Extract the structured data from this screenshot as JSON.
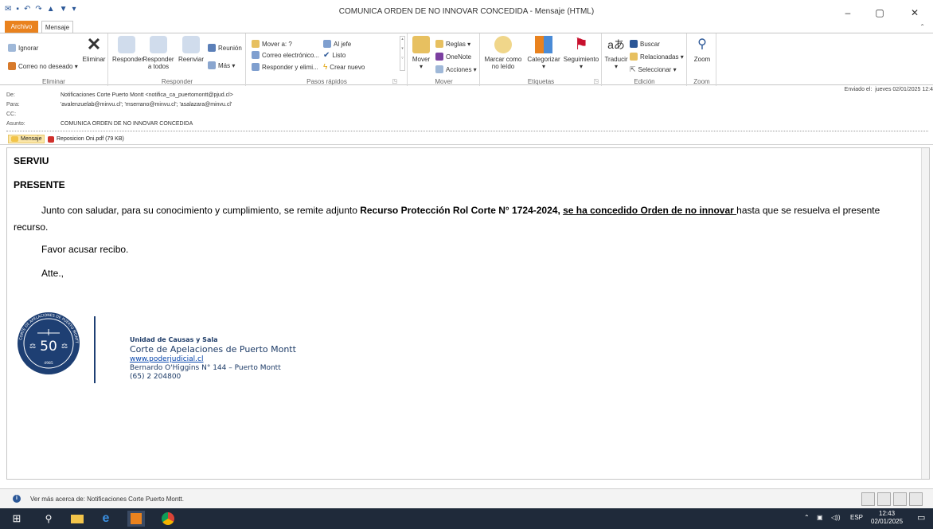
{
  "window": {
    "title": "COMUNICA ORDEN DE NO INNOVAR CONCEDIDA  -  Mensaje (HTML)",
    "controls": {
      "minimize": "–",
      "maximize": "▢",
      "close": "✕"
    }
  },
  "tabs": {
    "file": "Archivo",
    "message": "Mensaje",
    "collapse": "⌃"
  },
  "ribbon": {
    "delete_group": {
      "ignore": "Ignorar",
      "junk": "Correo no deseado ▾",
      "delete": "Eliminar",
      "label": "Eliminar"
    },
    "respond_group": {
      "reply": "Responder",
      "reply_all_1": "Responder",
      "reply_all_2": "a todos",
      "forward": "Reenviar",
      "meeting": "Reunión",
      "more": "Más ▾",
      "label": "Responder"
    },
    "quicksteps_group": {
      "move_to": "Mover a: ?",
      "boss": "Al jefe",
      "email": "Correo electrónico...",
      "done": "Listo",
      "reply_delete": "Responder y elimi...",
      "create_new": "Crear nuevo",
      "label": "Pasos rápidos"
    },
    "move_group": {
      "move": "Mover",
      "rules": "Reglas ▾",
      "onenote": "OneNote",
      "actions": "Acciones ▾",
      "label": "Mover"
    },
    "tags_group": {
      "mark_unread_1": "Marcar como",
      "mark_unread_2": "no leído",
      "categorize": "Categorizar",
      "followup": "Seguimiento",
      "label": "Etiquetas"
    },
    "edit_group": {
      "translate": "Traducir",
      "find": "Buscar",
      "related": "Relacionadas ▾",
      "select": "Seleccionar ▾",
      "label": "Edición"
    },
    "zoom_group": {
      "zoom": "Zoom",
      "label": "Zoom"
    }
  },
  "header": {
    "from_label": "De:",
    "from": "Notificaciones Corte Puerto Montt <notifica_ca_puertomontt@pjud.cl>",
    "to_label": "Para:",
    "to": "'avalenzuelab@minvu.cl'; 'mserrano@minvu.cl'; 'asalazara@minvu.cl'",
    "cc_label": "CC:",
    "cc": "",
    "subject_label": "Asunto:",
    "subject": "COMUNICA ORDEN DE NO INNOVAR CONCEDIDA",
    "sent_label": "Enviado el:",
    "sent": "jueves 02/01/2025 12:4"
  },
  "attachments": [
    {
      "name": "Mensaje"
    },
    {
      "name": "Reposicion Oni.pdf (79 KB)"
    }
  ],
  "body": {
    "line1": "SERVIU",
    "line2": "PRESENTE",
    "para_intro": "Junto con saludar, para su conocimiento y cumplimiento, se remite adjunto ",
    "para_bold": "Recurso Protección Rol Corte N° 1724-2024, ",
    "para_underlined": "se ha concedido Orden de no innovar ",
    "para_end": "hasta que se resuelva el presente",
    "para_wrap": "recurso.",
    "ack": "Favor acusar recibo.",
    "closing": "Atte.,"
  },
  "signature": {
    "seal_ring_text": "CORTE DE APELACIONES DE PUERTO MONTT",
    "seal_number": "50",
    "seal_year": "4985",
    "unit": "Unidad de Causas y Sala",
    "court": "Corte de Apelaciones de Puerto Montt",
    "website": "www.poderjudicial.cl",
    "address": "Bernardo O'Higgins N° 144 – Puerto Montt",
    "phone": "(65) 2 204800"
  },
  "statusbar": {
    "text": "Ver más acerca de: Notificaciones Corte Puerto Montt."
  },
  "taskbar": {
    "language": "ESP",
    "time": "12:43",
    "date": "02/01/2025"
  },
  "colors": {
    "accent": "#2b5797",
    "file_tab": "#e9821e",
    "taskbar": "#1f2a3a",
    "seal": "#1e3f73"
  }
}
